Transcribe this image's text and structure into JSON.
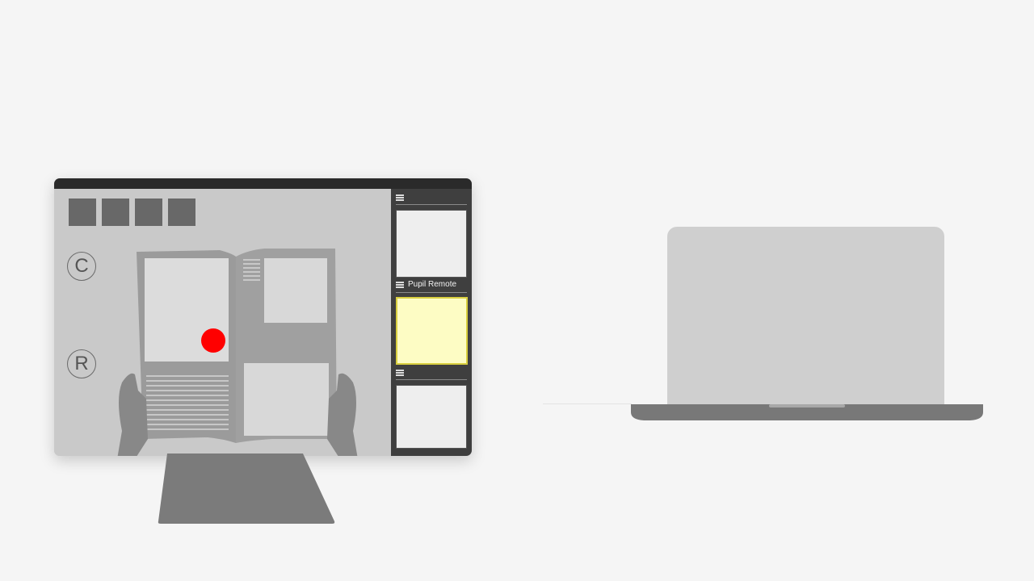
{
  "colors": {
    "background": "#f5f5f5",
    "monitor_frame": "#2a2a2a",
    "panel": "#3f3f3f",
    "active_thumb": "#fdfcc4",
    "gaze_dot": "#ff0000",
    "laptop": "#cfcfcf"
  },
  "monitor": {
    "toolbar": {
      "buttons": [
        "toolbar-button-1",
        "toolbar-button-2",
        "toolbar-button-3",
        "toolbar-button-4"
      ]
    },
    "circle_buttons": {
      "c_label": "C",
      "r_label": "R"
    },
    "gaze_marker": {
      "icon": "red-dot"
    }
  },
  "side_panel": {
    "sections": [
      {
        "title": "",
        "icon": "menu-icon"
      },
      {
        "title": "Pupil Remote",
        "icon": "menu-icon"
      },
      {
        "title": "",
        "icon": "menu-icon"
      }
    ]
  },
  "laptop": {
    "icon": "laptop-icon"
  }
}
